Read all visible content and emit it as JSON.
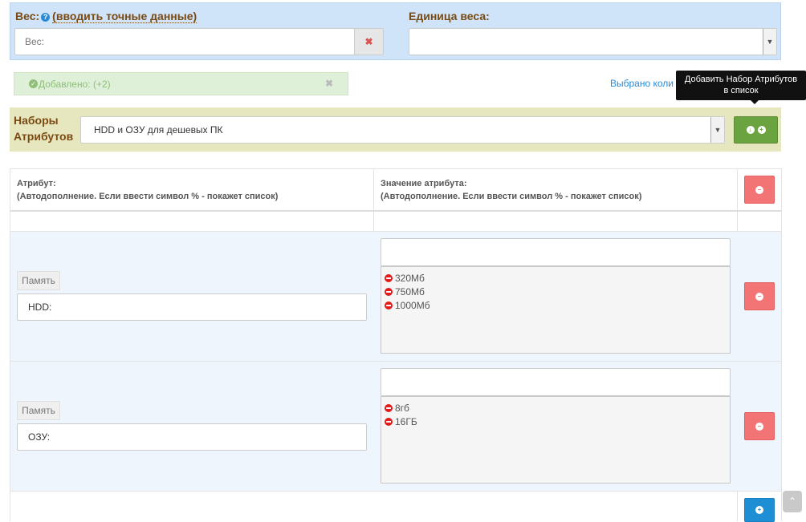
{
  "weight": {
    "label": "Вес:",
    "hint": "(вводить точные данные)",
    "placeholder": "Вес:",
    "clear_symbol": "✖"
  },
  "unit": {
    "label": "Единица веса:",
    "value": ""
  },
  "alert": {
    "text": "Добавлено: (+2)",
    "close_symbol": "✖"
  },
  "selected_count_text": "Выбрано коли",
  "tooltip": {
    "line1": "Добавить Набор Атрибутов",
    "line2": "в список"
  },
  "attribute_sets": {
    "label_line1": "Наборы",
    "label_line2": "Атрибутов",
    "selected": "HDD и ОЗУ для дешевых ПК"
  },
  "table": {
    "header_attr_line1": "Атрибут:",
    "header_attr_line2": "(Автодополнение. Если ввести символ % - покажет список)",
    "header_value_line1": "Значение атрибута:",
    "header_value_line2": "(Автодополнение. Если ввести символ % - покажет список)",
    "rows": [
      {
        "tag": "Память",
        "attribute": "HDD:",
        "value_input": "",
        "values": [
          "320Мб",
          "750Мб",
          "1000Мб"
        ]
      },
      {
        "tag": "Память",
        "attribute": "ОЗУ:",
        "value_input": "",
        "values": [
          "8гб",
          "16ГБ"
        ]
      }
    ]
  },
  "icons": {
    "help": "question-circle-icon",
    "check": "check-circle-icon",
    "down": "arrow-circle-down-icon",
    "plus": "plus-circle-icon",
    "minus": "minus-circle-icon",
    "remove": "remove-circle-icon",
    "scroll_up": "chevron-up-icon"
  },
  "colors": {
    "weight_panel": "#cfe3f9",
    "sets_bar": "#e7e7bf",
    "success": "#dff0d8",
    "green_button": "#6ca341",
    "red_button": "#f27474",
    "blue_button": "#1e8fd5",
    "label_brown": "#7a4a12"
  }
}
